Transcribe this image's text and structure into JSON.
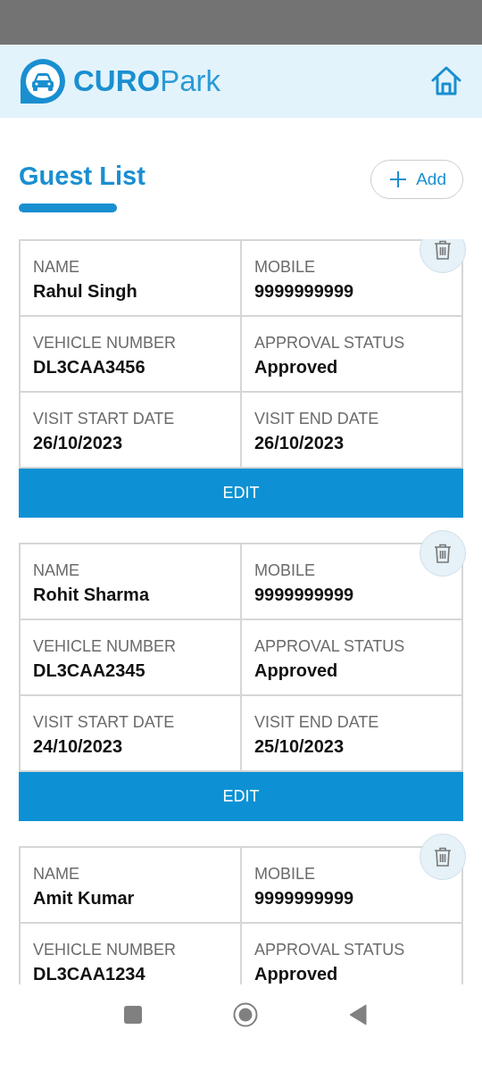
{
  "header": {
    "brand_bold": "CURO",
    "brand_light": "Park"
  },
  "page": {
    "title": "Guest List",
    "add_button": "Add"
  },
  "guests": [
    {
      "fields": [
        {
          "label": "NAME",
          "value": "Rahul Singh"
        },
        {
          "label": "MOBILE",
          "value": "9999999999"
        },
        {
          "label": "VEHICLE NUMBER",
          "value": "DL3CAA3456"
        },
        {
          "label": "APPROVAL STATUS",
          "value": "Approved"
        },
        {
          "label": "VISIT START DATE",
          "value": "26/10/2023"
        },
        {
          "label": "VISIT END DATE",
          "value": "26/10/2023"
        }
      ],
      "edit_button": "EDIT"
    },
    {
      "fields": [
        {
          "label": "NAME",
          "value": "Rohit Sharma"
        },
        {
          "label": "MOBILE",
          "value": "9999999999"
        },
        {
          "label": "VEHICLE NUMBER",
          "value": "DL3CAA2345"
        },
        {
          "label": "APPROVAL STATUS",
          "value": "Approved"
        },
        {
          "label": "VISIT START DATE",
          "value": "24/10/2023"
        },
        {
          "label": "VISIT END DATE",
          "value": "25/10/2023"
        }
      ],
      "edit_button": "EDIT"
    },
    {
      "fields": [
        {
          "label": "NAME",
          "value": "Amit Kumar"
        },
        {
          "label": "MOBILE",
          "value": "9999999999"
        },
        {
          "label": "VEHICLE NUMBER",
          "value": "DL3CAA1234"
        },
        {
          "label": "APPROVAL STATUS",
          "value": "Approved"
        }
      ]
    }
  ]
}
